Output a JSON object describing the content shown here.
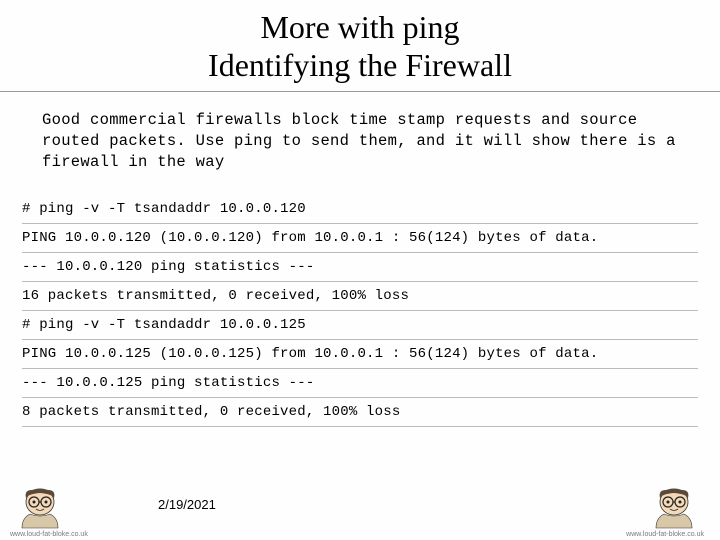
{
  "title": {
    "line1": "More with ping",
    "line2": "Identifying the Firewall"
  },
  "intro": "Good commercial firewalls block time stamp requests and source routed packets.  Use ping to send them, and it will show there is a firewall in the way",
  "code": [
    "# ping -v -T tsandaddr 10.0.0.120",
    "PING 10.0.0.120 (10.0.0.120) from 10.0.0.1 : 56(124) bytes of data.",
    "--- 10.0.0.120 ping statistics ---",
    "16 packets transmitted, 0 received, 100% loss",
    "# ping -v -T tsandaddr 10.0.0.125",
    "PING 10.0.0.125 (10.0.0.125) from 10.0.0.1 : 56(124) bytes of data.",
    "--- 10.0.0.125 ping statistics ---",
    "8 packets transmitted, 0 received, 100% loss"
  ],
  "footer": {
    "date": "2/19/2021",
    "credit_left": "www.loud-fat-bloke.co.uk",
    "credit_right": "www.loud-fat-bloke.co.uk"
  }
}
